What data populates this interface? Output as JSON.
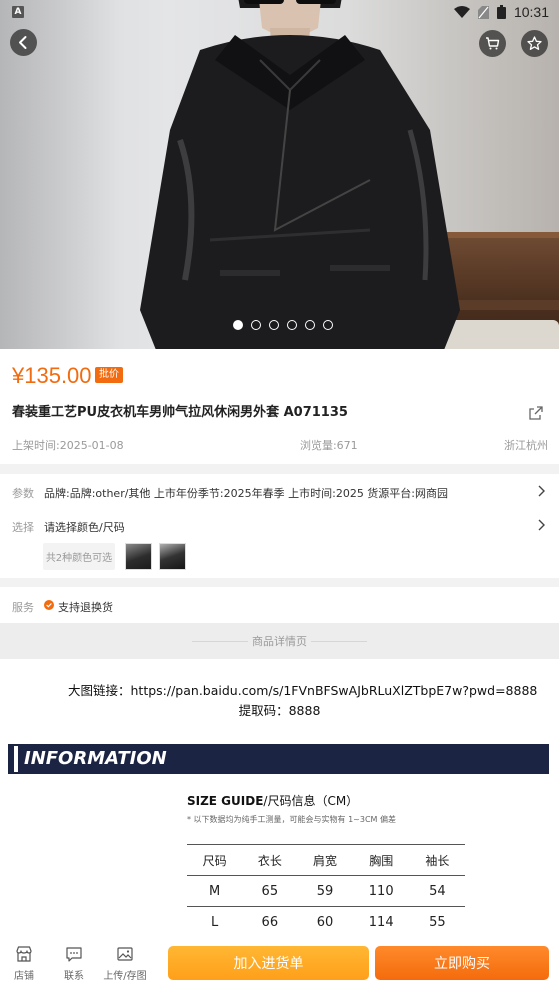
{
  "status_bar": {
    "time": "10:31",
    "left_badge": "A"
  },
  "gallery": {
    "image_count": 6,
    "active_index": 0
  },
  "product": {
    "price": "¥135.00",
    "price_tag": "批价",
    "title": "春装重工艺PU皮衣机车男帅气拉风休闲男外套  A071135",
    "listed_time": "上架时间:2025-01-08",
    "views": "浏览量:671",
    "location": "浙江杭州"
  },
  "params": {
    "label": "参数",
    "text": "品牌:品牌:other/其他 上市年份季节:2025年春季 上市时间:2025 货源平台:网商园"
  },
  "select": {
    "label": "选择",
    "text": "请选择颜色/尺码",
    "colors_hint": "共2种颜色可选"
  },
  "service": {
    "label": "服务",
    "text": "支持退换货"
  },
  "detail_header": "商品详情页",
  "description": {
    "link_line": "大图链接：https://pan.baidu.com/s/1FVnBFSwAJbRLuXlZTbpE7w?pwd=8888",
    "code_line": "提取码：8888",
    "banner": "INFORMATION",
    "size_guide_bold": "SIZE GUIDE",
    "size_guide_rest": "/尺码信息（CM）",
    "size_note": "* 以下数据均为纯手工测量，可能会与实物有 1~3CM 偏差",
    "size_headers": [
      "尺码",
      "衣长",
      "肩宽",
      "胸围",
      "袖长"
    ],
    "size_rows": [
      [
        "M",
        "65",
        "59",
        "110",
        "54"
      ],
      [
        "L",
        "66",
        "60",
        "114",
        "55"
      ]
    ]
  },
  "bottom_bar": {
    "shop": "店铺",
    "contact": "联系",
    "upload": "上传/存图",
    "add_to_cart": "加入进货单",
    "buy_now": "立即购买"
  },
  "colors": {
    "accent": "#f26b0f",
    "banner": "#1b2442"
  }
}
